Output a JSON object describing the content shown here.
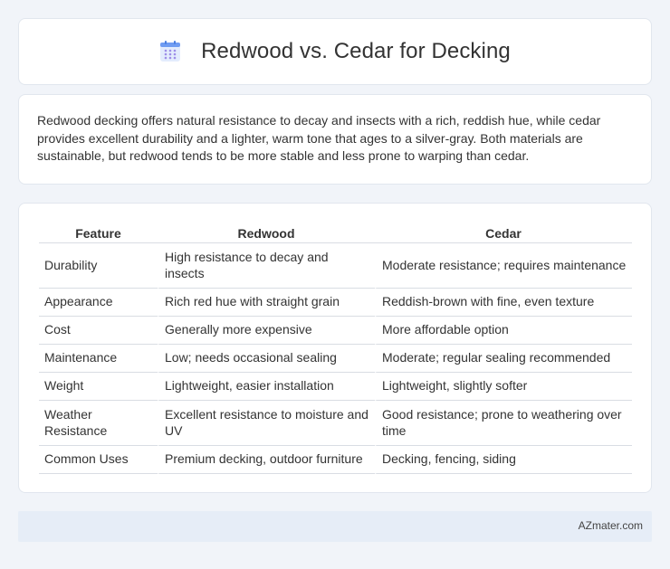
{
  "header": {
    "title": "Redwood vs. Cedar for Decking",
    "icon": "calendar-icon",
    "icon_color": "#5b8def"
  },
  "summary": {
    "text": "Redwood decking offers natural resistance to decay and insects with a rich, reddish hue, while cedar provides excellent durability and a lighter, warm tone that ages to a silver-gray. Both materials are sustainable, but redwood tends to be more stable and less prone to warping than cedar."
  },
  "table": {
    "headers": [
      "Feature",
      "Redwood",
      "Cedar"
    ],
    "rows": [
      [
        "Durability",
        "High resistance to decay and insects",
        "Moderate resistance; requires maintenance"
      ],
      [
        "Appearance",
        "Rich red hue with straight grain",
        "Reddish-brown with fine, even texture"
      ],
      [
        "Cost",
        "Generally more expensive",
        "More affordable option"
      ],
      [
        "Maintenance",
        "Low; needs occasional sealing",
        "Moderate; regular sealing recommended"
      ],
      [
        "Weight",
        "Lightweight, easier installation",
        "Lightweight, slightly softer"
      ],
      [
        "Weather Resistance",
        "Excellent resistance to moisture and UV",
        "Good resistance; prone to weathering over time"
      ],
      [
        "Common Uses",
        "Premium decking, outdoor furniture",
        "Decking, fencing, siding"
      ]
    ]
  },
  "footer": {
    "text": "AZmater.com"
  },
  "colors": {
    "page_background": "#f1f4f9",
    "card_background": "#ffffff",
    "footer_background": "#e6edf7"
  }
}
